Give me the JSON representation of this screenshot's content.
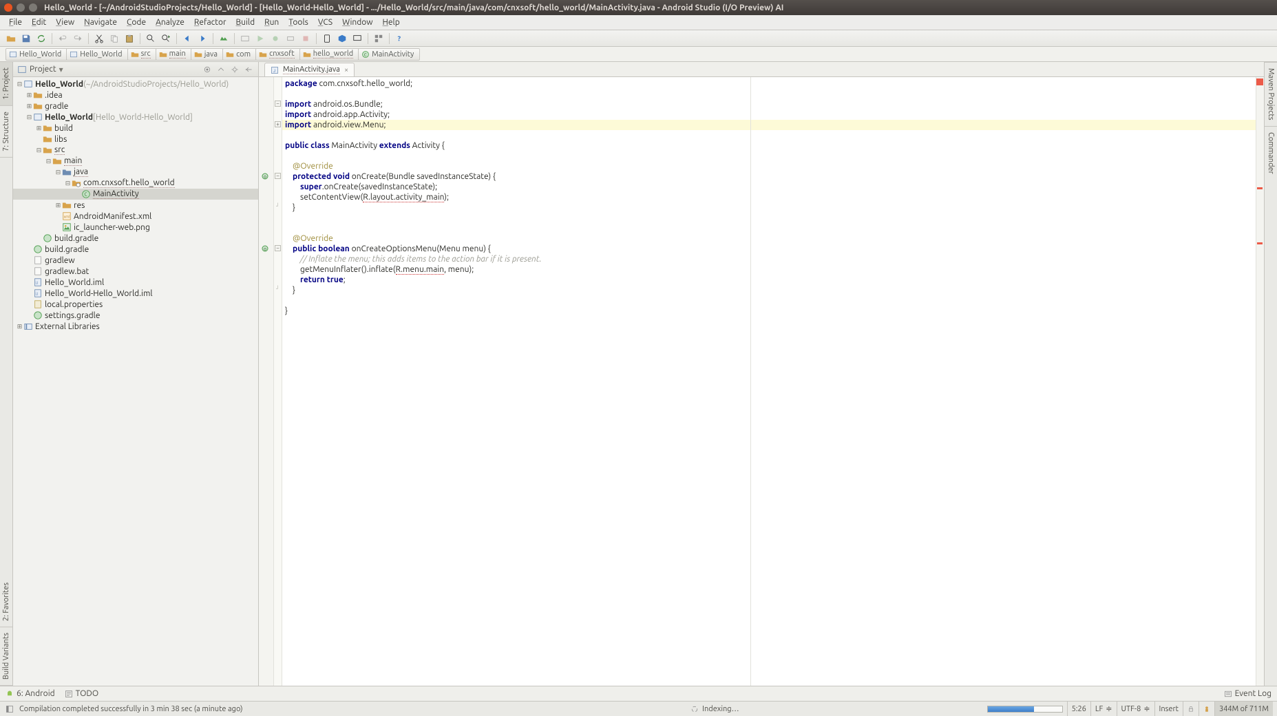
{
  "titlebar": "Hello_World - [~/AndroidStudioProjects/Hello_World] - [Hello_World-Hello_World] - .../Hello_World/src/main/java/com/cnxsoft/hello_world/MainActivity.java - Android Studio (I/O Preview) AI",
  "menu": [
    "File",
    "Edit",
    "View",
    "Navigate",
    "Code",
    "Analyze",
    "Refactor",
    "Build",
    "Run",
    "Tools",
    "VCS",
    "Window",
    "Help"
  ],
  "breadcrumb": [
    {
      "label": "Hello_World",
      "type": "module"
    },
    {
      "label": "Hello_World",
      "type": "module"
    },
    {
      "label": "src",
      "type": "folder-dotted"
    },
    {
      "label": "main",
      "type": "folder-dotted"
    },
    {
      "label": "java",
      "type": "folder"
    },
    {
      "label": "com",
      "type": "folder"
    },
    {
      "label": "cnxsoft",
      "type": "folder-dotted"
    },
    {
      "label": "hello_world",
      "type": "folder-dotted"
    },
    {
      "label": "MainActivity",
      "type": "class"
    }
  ],
  "projectHeader": {
    "label": "Project"
  },
  "tree": [
    {
      "d": 0,
      "t": "-",
      "icon": "module",
      "label": "Hello_World",
      "suffix": " (~/AndroidStudioProjects/Hello_World)",
      "bold": true
    },
    {
      "d": 1,
      "t": "+",
      "icon": "folder",
      "label": ".idea"
    },
    {
      "d": 1,
      "t": "+",
      "icon": "folder",
      "label": "gradle"
    },
    {
      "d": 1,
      "t": "-",
      "icon": "module",
      "label": "Hello_World",
      "suffix": " [Hello_World-Hello_World]",
      "bold": true
    },
    {
      "d": 2,
      "t": "+",
      "icon": "folder",
      "label": "build"
    },
    {
      "d": 2,
      "t": " ",
      "icon": "folder",
      "label": "libs"
    },
    {
      "d": 2,
      "t": "-",
      "icon": "folder",
      "label": "src",
      "dotted": true
    },
    {
      "d": 3,
      "t": "-",
      "icon": "folder",
      "label": "main",
      "dotted": true
    },
    {
      "d": 4,
      "t": "-",
      "icon": "folder-blue",
      "label": "java",
      "dotted": true
    },
    {
      "d": 5,
      "t": "-",
      "icon": "package",
      "label": "com.cnxsoft.hello_world",
      "dotted": true
    },
    {
      "d": 6,
      "t": " ",
      "icon": "class",
      "label": "MainActivity",
      "dotted": true,
      "sel": true
    },
    {
      "d": 4,
      "t": "+",
      "icon": "folder",
      "label": "res"
    },
    {
      "d": 4,
      "t": " ",
      "icon": "xml",
      "label": "AndroidManifest.xml"
    },
    {
      "d": 4,
      "t": " ",
      "icon": "image",
      "label": "ic_launcher-web.png"
    },
    {
      "d": 2,
      "t": " ",
      "icon": "gradle",
      "label": "build.gradle"
    },
    {
      "d": 1,
      "t": " ",
      "icon": "gradle",
      "label": "build.gradle"
    },
    {
      "d": 1,
      "t": " ",
      "icon": "file",
      "label": "gradlew"
    },
    {
      "d": 1,
      "t": " ",
      "icon": "file",
      "label": "gradlew.bat"
    },
    {
      "d": 1,
      "t": " ",
      "icon": "iml",
      "label": "Hello_World.iml"
    },
    {
      "d": 1,
      "t": " ",
      "icon": "iml",
      "label": "Hello_World-Hello_World.iml"
    },
    {
      "d": 1,
      "t": " ",
      "icon": "props",
      "label": "local.properties"
    },
    {
      "d": 1,
      "t": " ",
      "icon": "gradle",
      "label": "settings.gradle"
    },
    {
      "d": 0,
      "t": "+",
      "icon": "lib",
      "label": "External Libraries"
    }
  ],
  "editorTab": {
    "label": "MainActivity.java"
  },
  "code": {
    "lines": [
      {
        "content": [
          {
            "kw": "package"
          },
          {
            "p": " com.cnxsoft.hello_world;"
          }
        ]
      },
      {
        "content": []
      },
      {
        "fold": "-",
        "content": [
          {
            "kw": "import"
          },
          {
            "p": " android.os.Bundle;"
          }
        ]
      },
      {
        "content": [
          {
            "kw": "import"
          },
          {
            "p": " android.app.Activity;"
          }
        ]
      },
      {
        "fold": "+",
        "hl": true,
        "content": [
          {
            "kw": "import"
          },
          {
            "p": " android.view.Menu;"
          }
        ]
      },
      {
        "content": []
      },
      {
        "content": [
          {
            "kw": "public class"
          },
          {
            "p": " MainActivity "
          },
          {
            "kw": "extends"
          },
          {
            "p": " Activity {"
          }
        ]
      },
      {
        "content": []
      },
      {
        "content": [
          {
            "p": "    "
          },
          {
            "ann": "@Override"
          }
        ]
      },
      {
        "gutter": "o",
        "fold": "-",
        "content": [
          {
            "p": "    "
          },
          {
            "kw": "protected void"
          },
          {
            "p": " onCreate(Bundle savedInstanceState) {"
          }
        ]
      },
      {
        "content": [
          {
            "p": "        "
          },
          {
            "kw": "super"
          },
          {
            "p": ".onCreate(savedInstanceState);"
          }
        ]
      },
      {
        "content": [
          {
            "p": "        setContentView("
          },
          {
            "err": "R.layout.activity_main"
          },
          {
            "p": ");"
          }
        ]
      },
      {
        "fold": "e",
        "content": [
          {
            "p": "    }"
          }
        ]
      },
      {
        "content": []
      },
      {
        "content": []
      },
      {
        "content": [
          {
            "p": "    "
          },
          {
            "ann": "@Override"
          }
        ]
      },
      {
        "gutter": "o",
        "fold": "-",
        "content": [
          {
            "p": "    "
          },
          {
            "kw": "public boolean"
          },
          {
            "p": " onCreateOptionsMenu(Menu menu) {"
          }
        ]
      },
      {
        "content": [
          {
            "p": "        "
          },
          {
            "cmt": "// Inflate the menu; this adds items to the action bar if it is present."
          }
        ]
      },
      {
        "content": [
          {
            "p": "        getMenuInflater().inflate("
          },
          {
            "err": "R.menu.main"
          },
          {
            "p": ", menu);"
          }
        ]
      },
      {
        "content": [
          {
            "p": "        "
          },
          {
            "kw": "return true"
          },
          {
            "p": ";"
          }
        ]
      },
      {
        "fold": "e",
        "content": [
          {
            "p": "    }"
          }
        ]
      },
      {
        "content": []
      },
      {
        "content": [
          {
            "p": "}"
          }
        ]
      }
    ]
  },
  "sideTabsLeft": [
    {
      "label": "1: Project",
      "sel": true
    },
    {
      "label": "7: Structure"
    },
    {
      "label": "2: Favorites"
    },
    {
      "label": "Build Variants"
    }
  ],
  "sideTabsRight": [
    {
      "label": "Maven Projects"
    },
    {
      "label": "Commander"
    }
  ],
  "bottomTabs": {
    "android": "6: Android",
    "todo": "TODO",
    "eventlog": "Event Log"
  },
  "status": {
    "msg": "Compilation completed successfully in 3 min 38 sec (a minute ago)",
    "indexing": "  Indexing…",
    "caret": "5:26",
    "le": "LF",
    "enc": "UTF-8",
    "mode": "Insert",
    "mem": "344M of 711M"
  }
}
